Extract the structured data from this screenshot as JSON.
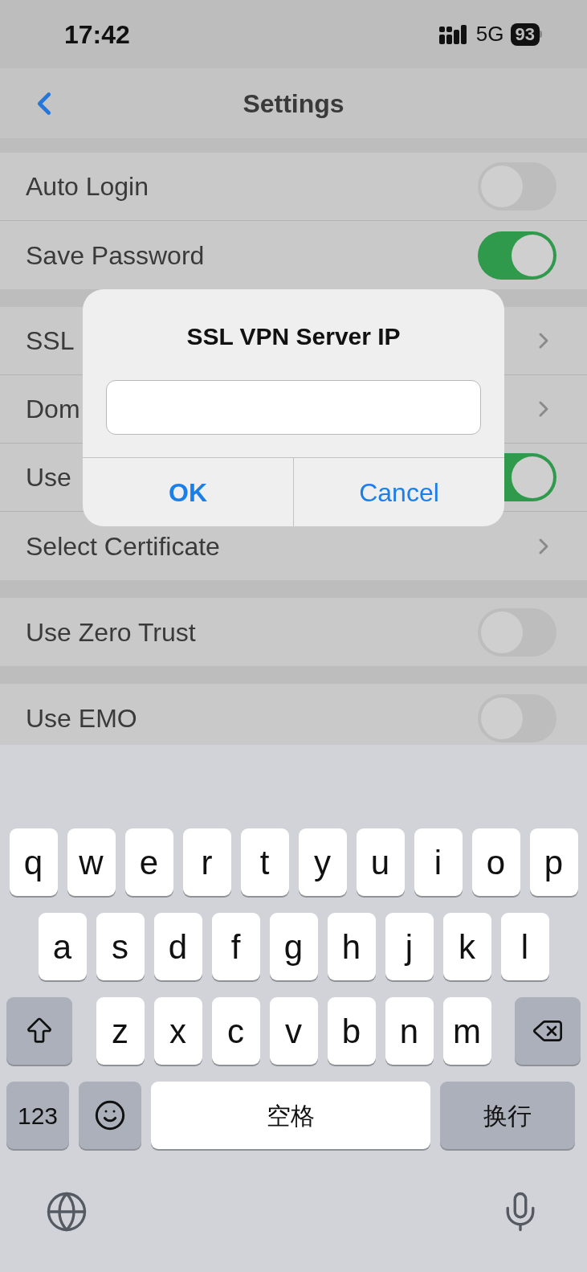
{
  "status_bar": {
    "time": "17:42",
    "network": "5G",
    "battery": "93"
  },
  "nav": {
    "title": "Settings"
  },
  "sections": [
    {
      "rows": [
        {
          "label": "Auto Login",
          "kind": "toggle",
          "on": false
        },
        {
          "label": "Save Password",
          "kind": "toggle",
          "on": true
        }
      ]
    },
    {
      "rows": [
        {
          "label": "SSL",
          "kind": "chevron"
        },
        {
          "label": "Dom",
          "kind": "chevron"
        },
        {
          "label": "Use",
          "kind": "toggle",
          "on": true
        },
        {
          "label": "Select Certificate",
          "kind": "chevron"
        }
      ]
    },
    {
      "rows": [
        {
          "label": "Use Zero Trust",
          "kind": "toggle",
          "on": false
        }
      ]
    },
    {
      "rows": [
        {
          "label": "Use EMO",
          "kind": "toggle",
          "on": false
        }
      ]
    }
  ],
  "dialog": {
    "title": "SSL VPN Server IP",
    "buttons": [
      {
        "label": "OK",
        "bold": true
      },
      {
        "label": "Cancel",
        "bold": false
      }
    ]
  },
  "keyboard": {
    "rows": [
      [
        "q",
        "w",
        "e",
        "r",
        "t",
        "y",
        "u",
        "i",
        "o",
        "p"
      ],
      [
        "a",
        "s",
        "d",
        "f",
        "g",
        "h",
        "j",
        "k",
        "l"
      ],
      [
        "z",
        "x",
        "c",
        "v",
        "b",
        "n",
        "m"
      ]
    ],
    "bottom": {
      "numbers": "123",
      "space": "空格",
      "return": "换行"
    }
  }
}
